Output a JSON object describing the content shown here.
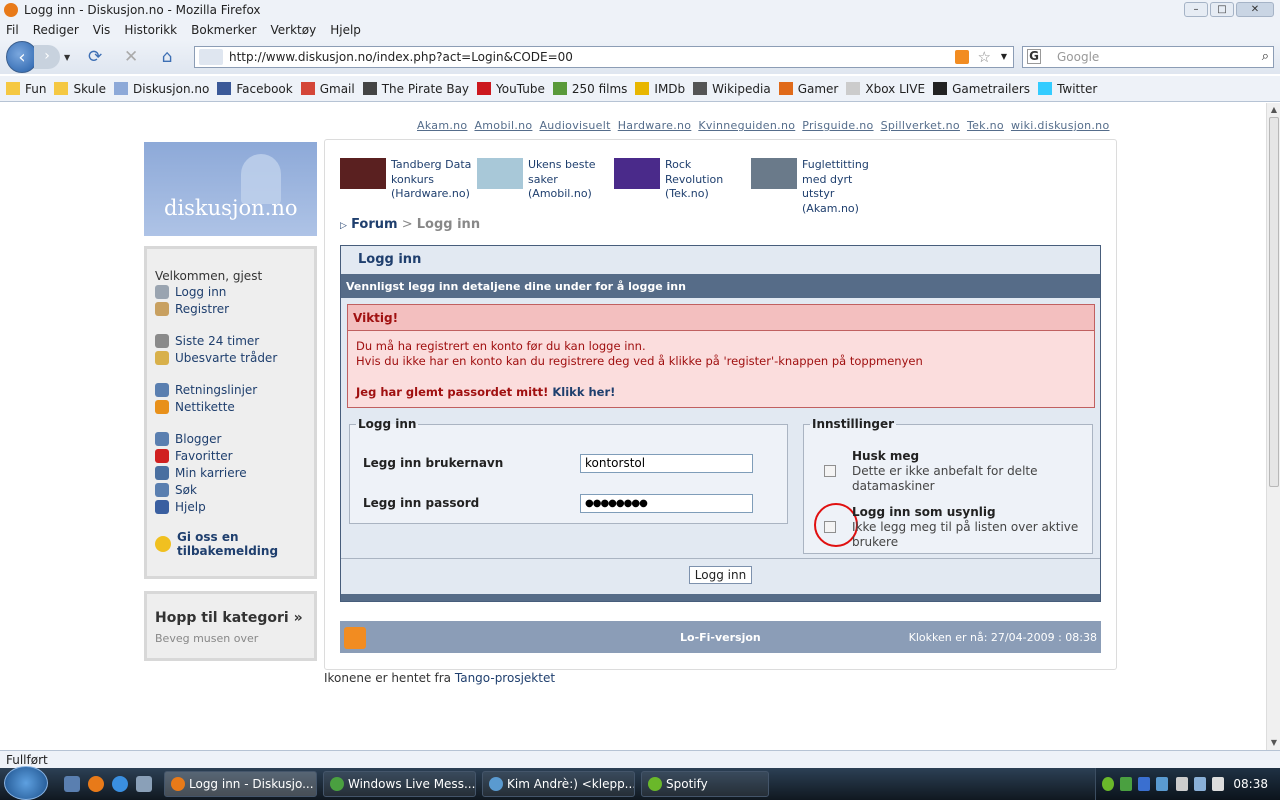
{
  "window": {
    "title": "Logg inn - Diskusjon.no - Mozilla Firefox"
  },
  "menu": [
    "Fil",
    "Rediger",
    "Vis",
    "Historikk",
    "Bokmerker",
    "Verktøy",
    "Hjelp"
  ],
  "url": "http://www.diskusjon.no/index.php?act=Login&CODE=00",
  "search_placeholder": "Google",
  "bookmarks": [
    {
      "label": "Fun",
      "icon": "folder-icon",
      "color": "#f5c842"
    },
    {
      "label": "Skule",
      "icon": "folder-icon",
      "color": "#f5c842"
    },
    {
      "label": "Diskusjon.no",
      "icon": "diskusjon-icon",
      "color": "#8da9d8"
    },
    {
      "label": "Facebook",
      "icon": "facebook-icon",
      "color": "#3b5998"
    },
    {
      "label": "Gmail",
      "icon": "google-icon",
      "color": "#d44638"
    },
    {
      "label": "The Pirate Bay",
      "icon": "pirate-ship-icon",
      "color": "#444444"
    },
    {
      "label": "YouTube",
      "icon": "youtube-icon",
      "color": "#cc181e"
    },
    {
      "label": "250 films",
      "icon": "films-icon",
      "color": "#5a9a3a"
    },
    {
      "label": "IMDb",
      "icon": "imdb-icon",
      "color": "#e8b600"
    },
    {
      "label": "Wikipedia",
      "icon": "wikipedia-icon",
      "color": "#555555"
    },
    {
      "label": "Gamer",
      "icon": "gamer-icon",
      "color": "#e06a1a"
    },
    {
      "label": "Xbox LIVE",
      "icon": "page-icon",
      "color": "#cccccc"
    },
    {
      "label": "Gametrailers",
      "icon": "gametrailers-icon",
      "color": "#222222"
    },
    {
      "label": "Twitter",
      "icon": "twitter-icon",
      "color": "#33ccff"
    }
  ],
  "toplinks": [
    "Akam.no",
    "Amobil.no",
    "Audiovisuelt",
    "Hardware.no",
    "Kvinneguiden.no",
    "Prisguide.no",
    "Spillverket.no",
    "Tek.no",
    "wiki.diskusjon.no"
  ],
  "logo_text": "diskusjon.no",
  "sidebar": {
    "welcome": "Velkommen, gjest",
    "groups": [
      [
        {
          "label": "Logg inn",
          "icon": "lock-icon",
          "color": "#9aa4b0"
        },
        {
          "label": "Registrer",
          "icon": "register-icon",
          "color": "#c8a060"
        }
      ],
      [
        {
          "label": "Siste 24 timer",
          "icon": "clock-icon",
          "color": "#8a8a8a"
        },
        {
          "label": "Ubesvarte tråder",
          "icon": "envelope-icon",
          "color": "#d8b04a"
        }
      ],
      [
        {
          "label": "Retningslinjer",
          "icon": "rules-icon",
          "color": "#5a7fb0"
        },
        {
          "label": "Nettikette",
          "icon": "warning-icon",
          "color": "#e8901a"
        }
      ],
      [
        {
          "label": "Blogger",
          "icon": "blog-icon",
          "color": "#5a7fb0"
        },
        {
          "label": "Favoritter",
          "icon": "heart-icon",
          "color": "#d02020"
        },
        {
          "label": "Min karriere",
          "icon": "footprints-icon",
          "color": "#4a6fa0"
        },
        {
          "label": "Søk",
          "icon": "search-icon",
          "color": "#5a7fb0"
        },
        {
          "label": "Hjelp",
          "icon": "help-icon",
          "color": "#3a5fa0"
        }
      ]
    ],
    "feedback": "Gi oss en tilbakemelding",
    "jump_title": "Hopp til kategori »",
    "jump_sub": "Beveg musen over"
  },
  "news": [
    {
      "title": "Tandberg Data konkurs",
      "source": "(Hardware.no)",
      "thumb": "#5a2020"
    },
    {
      "title": "Ukens beste saker",
      "source": "(Amobil.no)",
      "thumb": "#a8c8d8"
    },
    {
      "title": "Rock Revolution",
      "source": "(Tek.no)",
      "thumb": "#4a2a8a"
    },
    {
      "title": "Fuglettitting med dyrt utstyr",
      "source": "(Akam.no)",
      "thumb": "#6a7a8a"
    }
  ],
  "breadcrumb": {
    "forum": "Forum",
    "sep": ">",
    "current": "Logg inn"
  },
  "login": {
    "heading": "Logg inn",
    "subheading": "Vennligst legg inn detaljene dine under for å logge inn",
    "important_title": "Viktig!",
    "important_line1": "Du må ha registrert en konto før du kan logge inn.",
    "important_line2": "Hvis du ikke har en konto kan du registrere deg ved å klikke på 'register'-knappen på toppmenyen",
    "forgot_text": "Jeg har glemt passordet mitt!",
    "forgot_link": "Klikk her!",
    "fieldset_login": "Logg inn",
    "username_label": "Legg inn brukernavn",
    "username_value": "kontorstol",
    "password_label": "Legg inn passord",
    "password_value": "●●●●●●●●",
    "fieldset_settings": "Innstillinger",
    "remember_title": "Husk meg",
    "remember_desc": "Dette er ikke anbefalt for delte datamaskiner",
    "invisible_title": "Logg inn som usynlig",
    "invisible_desc": "Ikke legg meg til på listen over aktive brukere",
    "submit": "Logg inn"
  },
  "footer": {
    "lofi": "Lo-Fi-versjon",
    "clock": "Klokken er nå: 27/04-2009 : 08:38"
  },
  "credit": {
    "text": "Ikonene er hentet fra",
    "link": "Tango-prosjektet"
  },
  "status": "Fullført",
  "taskbar": {
    "tasks": [
      "Logg inn - Diskusjo...",
      "Windows Live Mess...",
      "Kim Andrè:) <klepp...",
      "Spotify"
    ],
    "time": "08:38"
  }
}
